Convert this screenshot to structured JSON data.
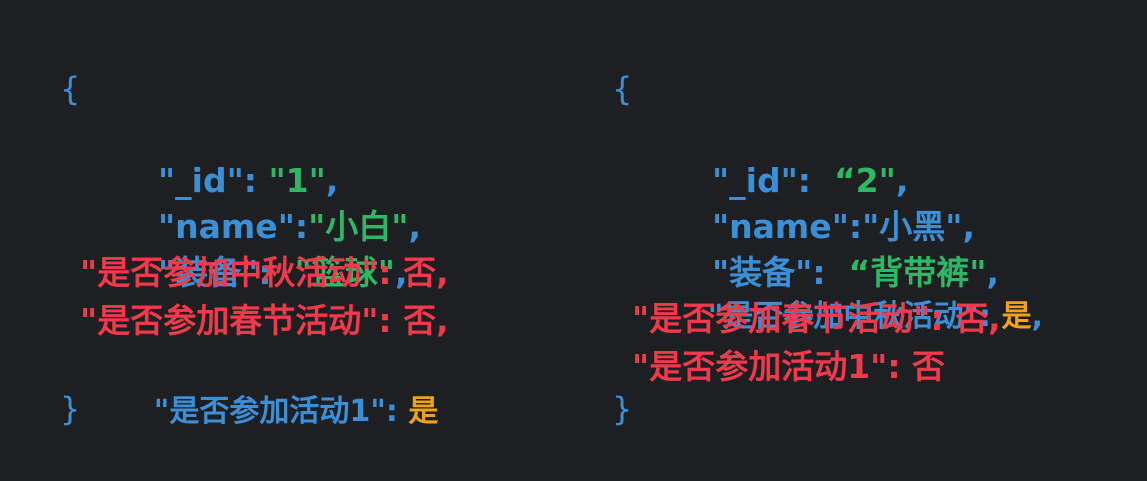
{
  "colors": {
    "background": "#1e1f22",
    "key_blue": "#3b8fd6",
    "value_green": "#2eb866",
    "highlight_red": "#f0394a",
    "yes_orange": "#f0a21e"
  },
  "left": {
    "open_brace": "{",
    "id_key": "\"_id\"",
    "id_sep": ": ",
    "id_value": "\"1\"",
    "id_comma": ",",
    "name_key": "\"name\"",
    "name_sep": ":",
    "name_value": "\"小白\"",
    "name_comma": ",",
    "equip_key": "\"装备\"",
    "equip_sep": ":  ",
    "equip_value": "\"篮球\"",
    "equip_comma": ",",
    "mid_autumn_line": "\"是否参加中秋活动\": 否,",
    "spring_line": "\"是否参加春节活动\": 否,",
    "activity1_key": "\"是否参加活动1\"",
    "activity1_sep": ": ",
    "activity1_value": "是",
    "close_brace": "}"
  },
  "right": {
    "open_brace": "{",
    "id_key": "\"_id\"",
    "id_sep": ":  ",
    "id_value": "“2\"",
    "id_comma": ",",
    "name_key": "\"name\"",
    "name_sep": ":",
    "name_value": "\"小黑\"",
    "name_comma": ",",
    "equip_key": "\"装备\"",
    "equip_sep": ":  ",
    "equip_value": "“背带裤\"",
    "equip_comma": ",",
    "mid_autumn_key": "\"是否参加中秋活动\"",
    "mid_autumn_sep": ": ",
    "mid_autumn_value": "是",
    "mid_autumn_comma": ",",
    "spring_line": "\"是否参加春节活动\": 否,",
    "activity1_line": "\"是否参加活动1\": 否",
    "close_brace": "}"
  }
}
